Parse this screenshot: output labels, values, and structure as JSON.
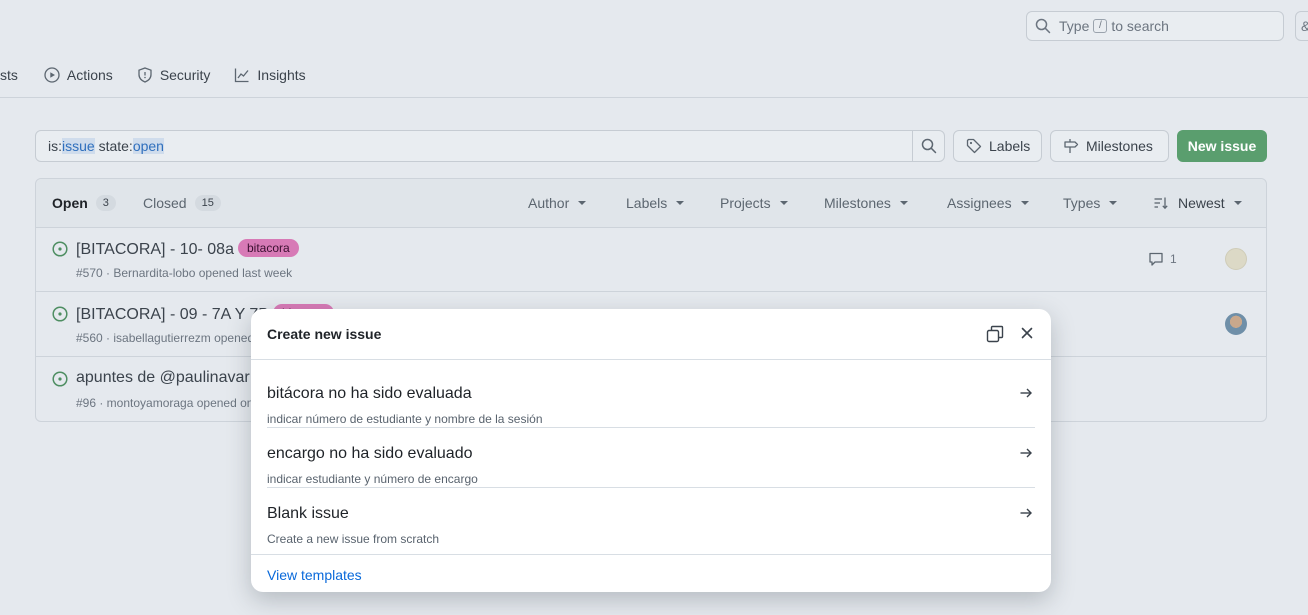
{
  "header": {
    "search_placeholder_prefix": "Type",
    "search_key": "/",
    "search_placeholder_suffix": "to search",
    "extra_button": "&"
  },
  "nav": {
    "items": [
      {
        "label": "sts",
        "icon": "pull-request-icon"
      },
      {
        "label": "Actions",
        "icon": "play-icon"
      },
      {
        "label": "Security",
        "icon": "shield-icon"
      },
      {
        "label": "Insights",
        "icon": "graph-icon"
      }
    ]
  },
  "filter": {
    "parts": [
      "is:",
      "issue",
      " state:",
      "open"
    ],
    "labels_button": "Labels",
    "milestones_button": "Milestones",
    "new_issue_button": "New issue"
  },
  "list": {
    "open_label": "Open",
    "open_count": "3",
    "closed_label": "Closed",
    "closed_count": "15",
    "filters": [
      "Author",
      "Labels",
      "Projects",
      "Milestones",
      "Assignees",
      "Types",
      "Newest"
    ],
    "issues": [
      {
        "title": "[BITACORA] - 10- 08a",
        "label": "bitacora",
        "meta": "#570 · Bernardita-lobo opened last week",
        "comments": "1"
      },
      {
        "title": "[BITACORA] - 09 - 7A Y 7B",
        "label": "bitacora",
        "meta": "#560 · isabellagutierrezm opened"
      },
      {
        "title": "apuntes de @paulinavar",
        "meta": "#96 · montoyamoraga opened on"
      }
    ]
  },
  "dialog": {
    "title": "Create new issue",
    "templates": [
      {
        "name": "bitácora no ha sido evaluada",
        "desc": "indicar número de estudiante y nombre de la sesión"
      },
      {
        "name": "encargo no ha sido evaluado",
        "desc": "indicar estudiante y número de encargo"
      },
      {
        "name": "Blank issue",
        "desc": "Create a new issue from scratch"
      }
    ],
    "footer_link": "View templates"
  },
  "colors": {
    "accent_green": "#5a9e6e",
    "label_pink": "#d77ab6",
    "link_blue": "#0969da"
  }
}
